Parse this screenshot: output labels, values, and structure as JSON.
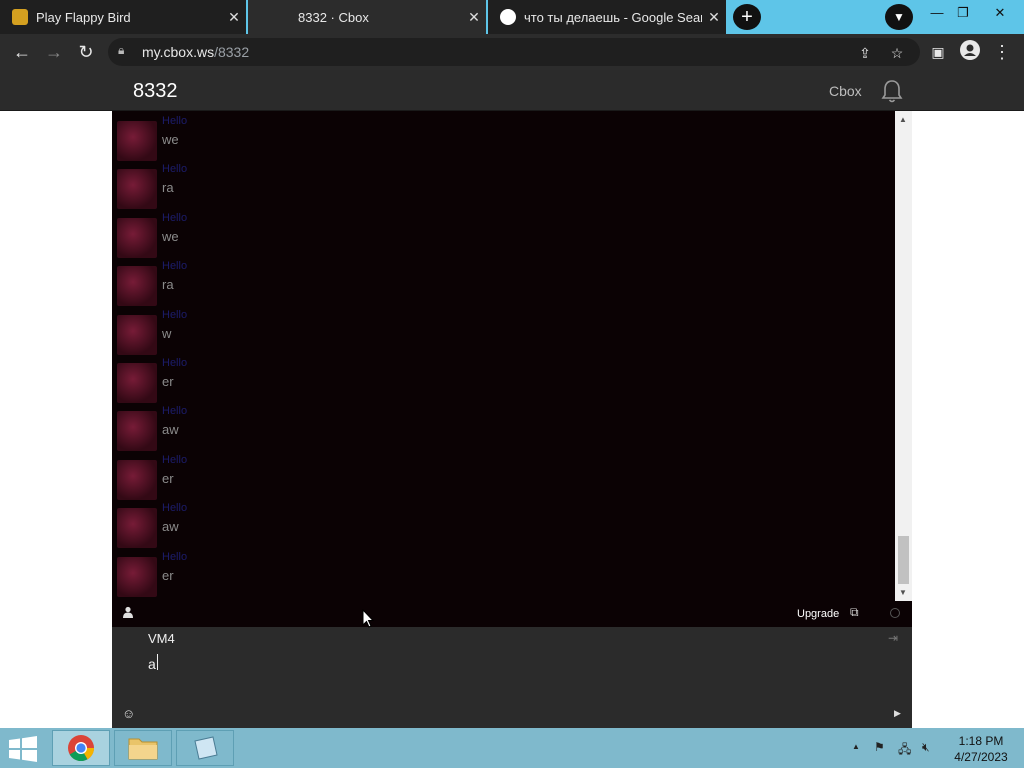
{
  "browser": {
    "tabs": [
      {
        "title": "Play Flappy Bird",
        "active": false
      },
      {
        "title": "8332 · Cbox",
        "active": true
      },
      {
        "title": "что ты делаешь - Google Search",
        "active": false
      }
    ],
    "url_host": "my.cbox.ws",
    "url_path": "/8332"
  },
  "site": {
    "brand": "8332",
    "nav_link": "Cbox"
  },
  "messages": [
    {
      "name": "Hello",
      "text": "we"
    },
    {
      "name": "Hello",
      "text": "ra"
    },
    {
      "name": "Hello",
      "text": "we"
    },
    {
      "name": "Hello",
      "text": "ra"
    },
    {
      "name": "Hello",
      "text": "w"
    },
    {
      "name": "Hello",
      "text": "er"
    },
    {
      "name": "Hello",
      "text": "aw"
    },
    {
      "name": "Hello",
      "text": "er"
    },
    {
      "name": "Hello",
      "text": "aw"
    },
    {
      "name": "Hello",
      "text": "er"
    }
  ],
  "chatbar": {
    "upgrade": "Upgrade"
  },
  "compose": {
    "nick": "VM4",
    "message": "a"
  },
  "taskbar": {
    "time": "1:18 PM",
    "date": "4/27/2023"
  },
  "colors": {
    "chat_bg": "#0b0204",
    "header_bg": "#2b2b2b",
    "taskbar_bg": "#7fb9cc",
    "tabbar_bg": "#5ec5e8"
  }
}
